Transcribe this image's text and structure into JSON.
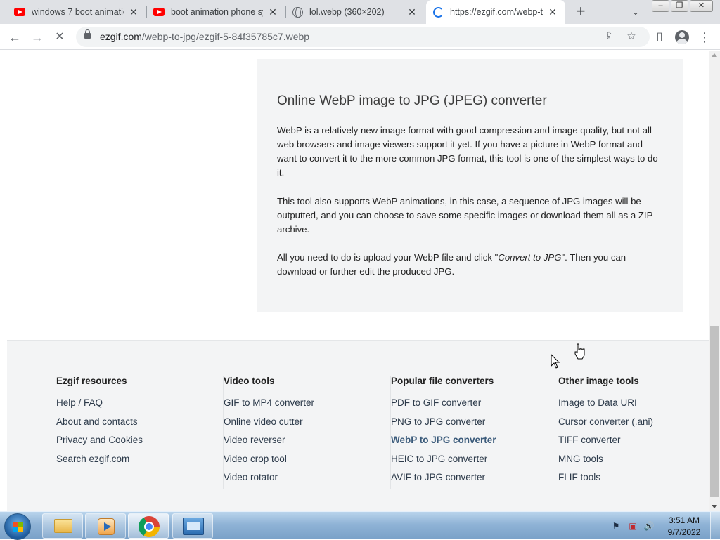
{
  "browser": {
    "tabs": [
      {
        "title": "windows 7 boot animation",
        "icon": "youtube-icon",
        "active": false
      },
      {
        "title": "boot animation phone sy",
        "icon": "youtube-icon",
        "active": false
      },
      {
        "title": "lol.webp (360×202)",
        "icon": "globe-icon",
        "active": false
      },
      {
        "title": "https://ezgif.com/webp-t",
        "icon": "loading-spinner-icon",
        "active": true
      }
    ],
    "new_tab_label": "+",
    "tab_search_label": "⌄",
    "window_controls": {
      "minimize": "–",
      "maximize": "❐",
      "close": "✕"
    },
    "toolbar": {
      "back": "←",
      "forward": "→",
      "reload_stop": "✕"
    },
    "url": {
      "host": "ezgif.com",
      "path": "/webp-to-jpg/ezgif-5-84f35785c7.webp"
    },
    "icons": {
      "share": "⇪",
      "bookmark": "☆",
      "side_panel": "▯",
      "menu": "⋮"
    }
  },
  "content": {
    "title": "Online WebP image to JPG (JPEG) converter",
    "para1": "WebP is a relatively new image format with good compression and image quality, but not all web browsers and image viewers support it yet. If you have a picture in WebP format and want to convert it to the more common JPG format, this tool is one of the simplest ways to do it.",
    "para2": "This tool also supports WebP animations, in this case, a sequence of JPG images will be outputted, and you can choose to save some specific images or download them all as a ZIP archive.",
    "para3_pre": "All you need to do is upload your WebP file and click \"",
    "para3_em": "Convert to JPG",
    "para3_post": "\". Then you can download or further edit the produced JPG."
  },
  "footer": {
    "columns": [
      {
        "heading": "Ezgif resources",
        "links": [
          "Help / FAQ",
          "About and contacts",
          "Privacy and Cookies",
          "Search ezgif.com"
        ]
      },
      {
        "heading": "Video tools",
        "links": [
          "GIF to MP4 converter",
          "Online video cutter",
          "Video reverser",
          "Video crop tool",
          "Video rotator"
        ]
      },
      {
        "heading": "Popular file converters",
        "links": [
          "PDF to GIF converter",
          "PNG to JPG converter",
          "WebP to JPG converter",
          "HEIC to JPG converter",
          "AVIF to JPG converter"
        ]
      },
      {
        "heading": "Other image tools",
        "links": [
          "Image to Data URI",
          "Cursor converter (.ani)",
          "TIFF converter",
          "MNG tools",
          "FLIF tools"
        ]
      }
    ],
    "current_link": "WebP to JPG converter"
  },
  "taskbar": {
    "apps": [
      "explorer-folder-icon",
      "media-player-icon",
      "chrome-icon",
      "control-panel-icon"
    ],
    "tray_icons": {
      "action_center": "⚑",
      "network": "▣",
      "volume": "🔊"
    },
    "time": "3:51 AM",
    "date": "9/7/2022"
  }
}
